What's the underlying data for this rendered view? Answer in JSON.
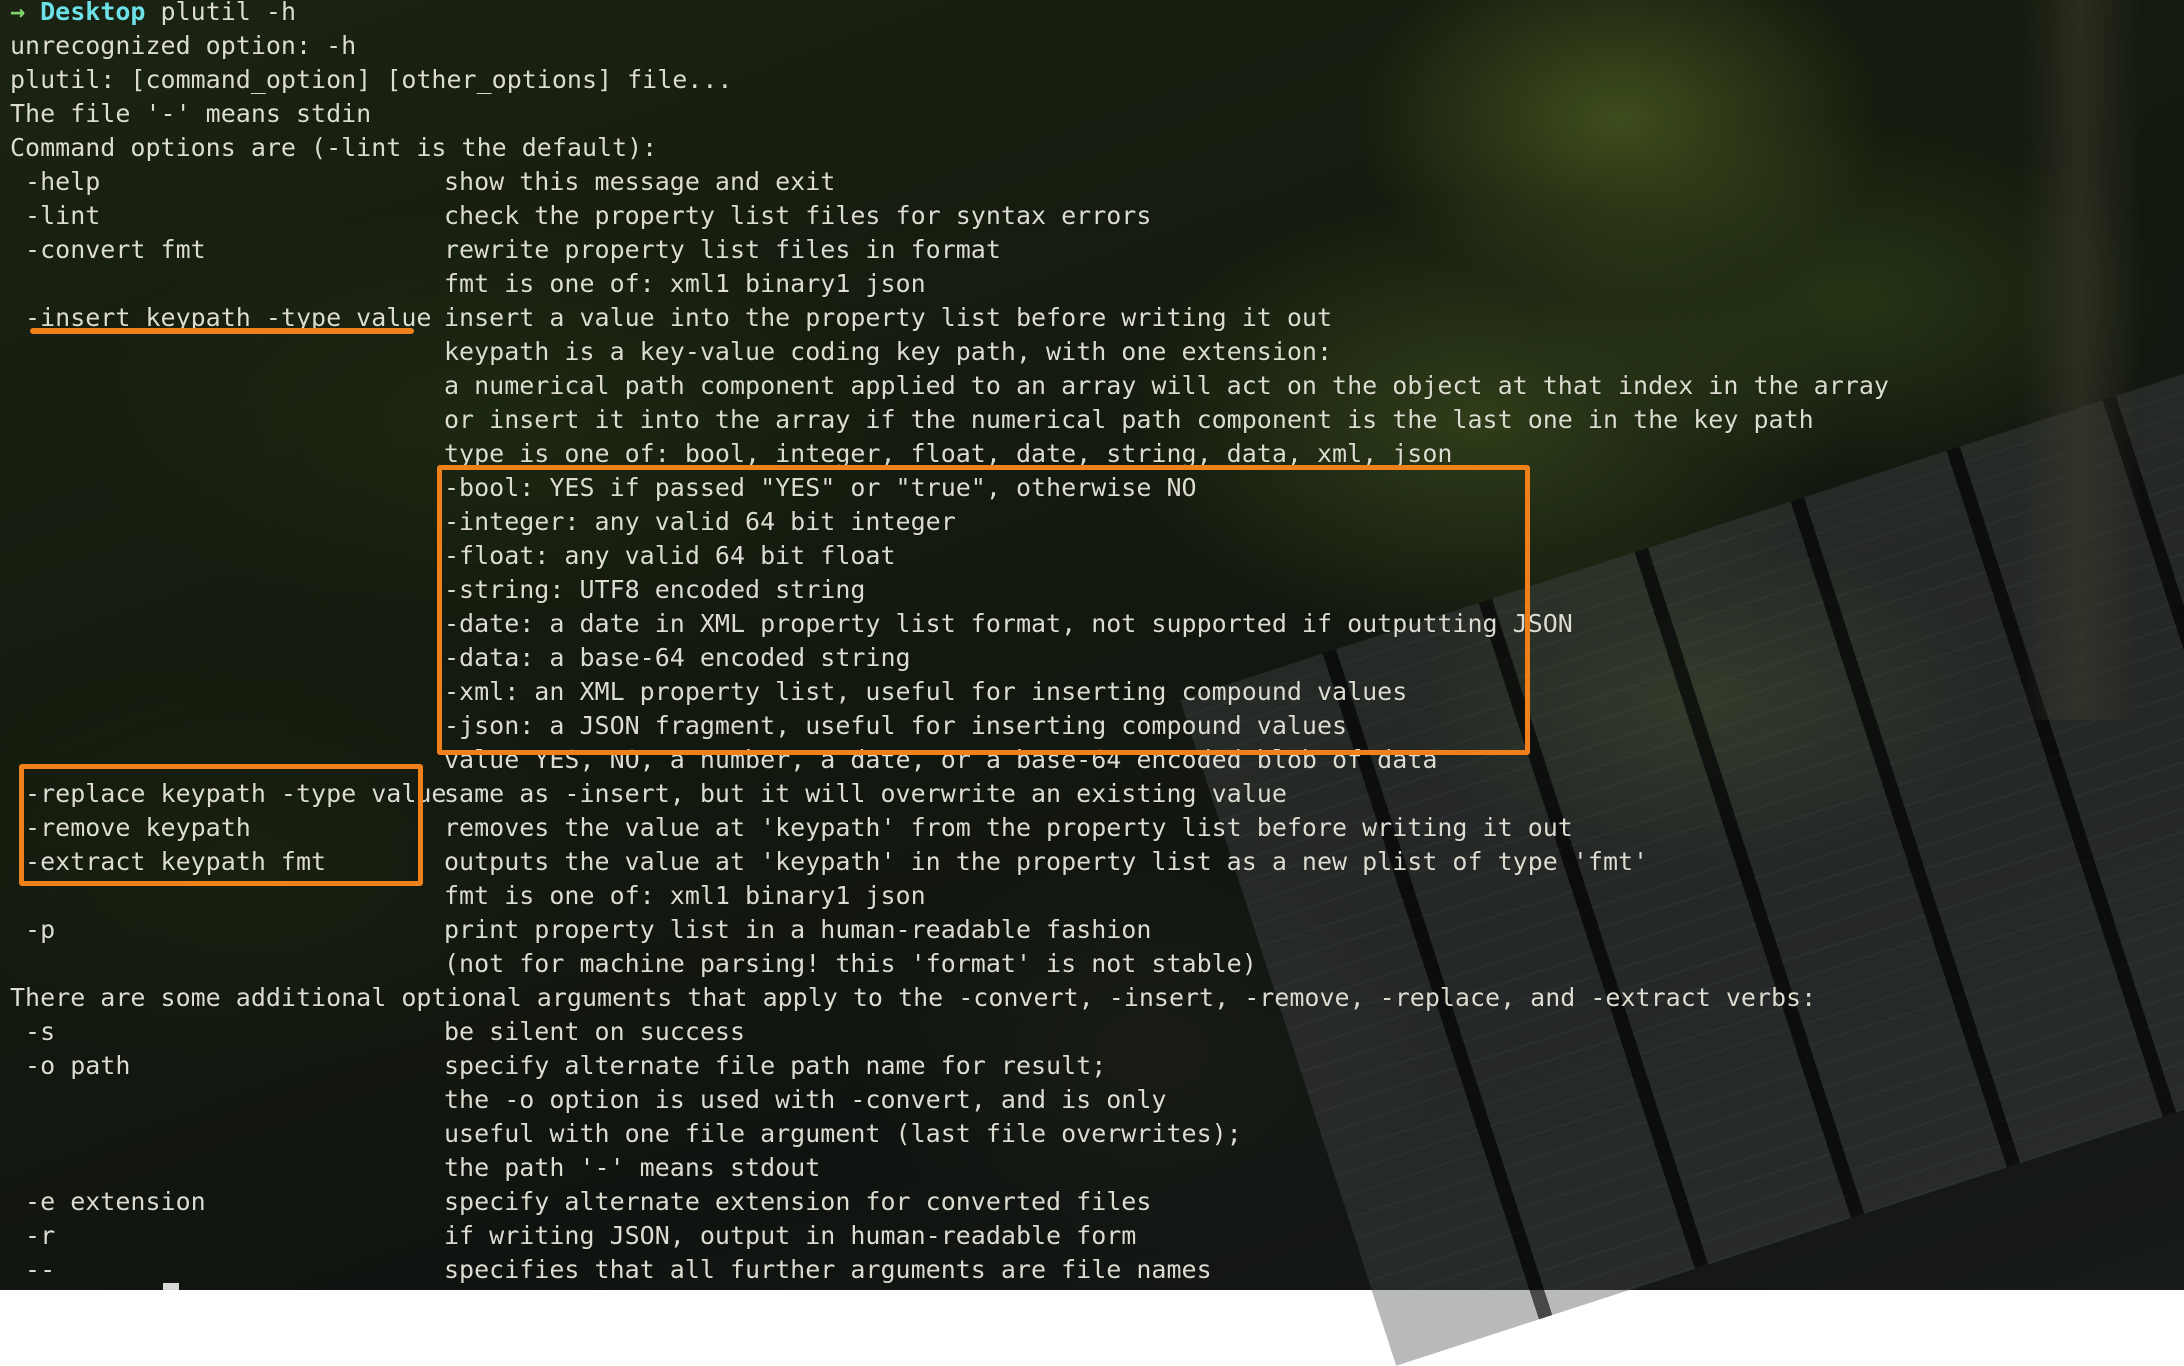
{
  "prompt": {
    "arrow": "→",
    "directory": "Desktop",
    "command": "plutil -h"
  },
  "output": {
    "l1": "unrecognized option: -h",
    "l2": "plutil: [command_option] [other_options] file...",
    "l3": "The file '-' means stdin",
    "l4": "Command options are (-lint is the default):",
    "help_opt": " -help",
    "help_desc": "show this message and exit",
    "lint_opt": " -lint",
    "lint_desc": "check the property list files for syntax errors",
    "convert_opt": " -convert fmt",
    "convert_desc": "rewrite property list files in format",
    "convert_fmt": "fmt is one of: xml1 binary1 json",
    "insert_opt": " -insert keypath -type value",
    "insert_desc": "insert a value into the property list before writing it out",
    "insert_d2": "keypath is a key-value coding key path, with one extension:",
    "insert_d3": "a numerical path component applied to an array will act on the object at that index in the array",
    "insert_d4": "or insert it into the array if the numerical path component is the last one in the key path",
    "insert_d5": "type is one of: bool, integer, float, date, string, data, xml, json",
    "type_bool": "-bool: YES if passed \"YES\" or \"true\", otherwise NO",
    "type_integer": "-integer: any valid 64 bit integer",
    "type_float": "-float: any valid 64 bit float",
    "type_string": "-string: UTF8 encoded string",
    "type_date": "-date: a date in XML property list format, not supported if outputting JSON",
    "type_data": "-data: a base-64 encoded string",
    "type_xml": "-xml: an XML property list, useful for inserting compound values",
    "type_json": "-json: a JSON fragment, useful for inserting compound values",
    "value_desc": "value YES, NO, a number, a date, or a base-64 encoded blob of data",
    "replace_opt": " -replace keypath -type value",
    "replace_desc": "same as -insert, but it will overwrite an existing value",
    "remove_opt": " -remove keypath",
    "remove_desc": "removes the value at 'keypath' from the property list before writing it out",
    "extract_opt": " -extract keypath fmt",
    "extract_desc": "outputs the value at 'keypath' in the property list as a new plist of type 'fmt'",
    "extract_fmt": "fmt is one of: xml1 binary1 json",
    "p_opt": " -p",
    "p_desc": "print property list in a human-readable fashion",
    "p_desc2": "(not for machine parsing! this 'format' is not stable)",
    "additional": "There are some additional optional arguments that apply to the -convert, -insert, -remove, -replace, and -extract verbs:",
    "s_opt": " -s",
    "s_desc": "be silent on success",
    "o_opt": " -o path",
    "o_desc": "specify alternate file path name for result;",
    "o_desc2": "the -o option is used with -convert, and is only",
    "o_desc3": "useful with one file argument (last file overwrites);",
    "o_desc4": "the path '-' means stdout",
    "e_opt": " -e extension",
    "e_desc": "specify alternate extension for converted files",
    "r_opt": " -r",
    "r_desc": "if writing JSON, output in human-readable form",
    "dd_opt": " --",
    "dd_desc": "specifies that all further arguments are file names"
  },
  "colors": {
    "highlight": "#f08019",
    "text": "#dcdcd0",
    "prompt_arrow": "#7fd36b",
    "prompt_dir": "#6ee0e8"
  }
}
